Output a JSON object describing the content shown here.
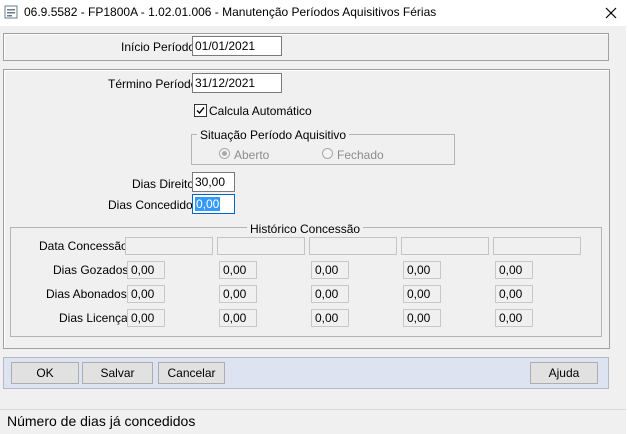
{
  "window": {
    "title": "06.9.5582 - FP1800A - 1.02.01.006 - Manutenção Períodos Aquisitivos Férias",
    "close_glyph": "✕"
  },
  "periodo": {
    "inicio_label": "Início Período:",
    "inicio_value": "01/01/2021",
    "termino_label": "Término Período:",
    "termino_value": "31/12/2021",
    "calcula_label": "Calcula Automático",
    "calcula_checked": true
  },
  "situacao": {
    "legend": "Situação Período Aquisitivo",
    "options": [
      "Aberto",
      "Fechado"
    ],
    "selected": "Aberto"
  },
  "dias": {
    "direito_label": "Dias Direito:",
    "direito_value": "30,00",
    "concedidos_label": "Dias Concedidos:",
    "concedidos_value": "0,00"
  },
  "historico": {
    "legend": "Histórico Concessão",
    "rows": [
      {
        "label": "Data Concessão:",
        "values": [
          "",
          "",
          "",
          "",
          ""
        ]
      },
      {
        "label": "Dias Gozados:",
        "values": [
          "0,00",
          "0,00",
          "0,00",
          "0,00",
          "0,00"
        ]
      },
      {
        "label": "Dias Abonados:",
        "values": [
          "0,00",
          "0,00",
          "0,00",
          "0,00",
          "0,00"
        ]
      },
      {
        "label": "Dias Licença:",
        "values": [
          "0,00",
          "0,00",
          "0,00",
          "0,00",
          "0,00"
        ]
      }
    ]
  },
  "buttons": {
    "ok": "OK",
    "salvar": "Salvar",
    "cancelar": "Cancelar",
    "ajuda": "Ajuda"
  },
  "status": {
    "text": "Número de dias já concedidos"
  },
  "colors": {
    "selection": "#3399ff",
    "button_bar": "#dde3f0",
    "window_bg": "#f0f0f0"
  }
}
